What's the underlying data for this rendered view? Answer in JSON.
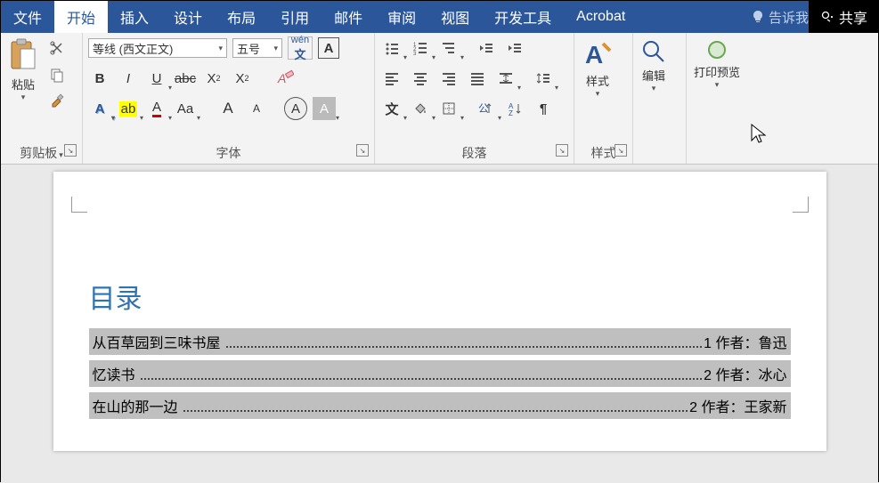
{
  "tabs": {
    "file": "文件",
    "home": "开始",
    "insert": "插入",
    "design": "设计",
    "layout": "布局",
    "refs": "引用",
    "mailings": "邮件",
    "review": "审阅",
    "view": "视图",
    "developer": "开发工具",
    "acrobat": "Acrobat",
    "tellme": "告诉我",
    "share": "共享"
  },
  "ribbon": {
    "clipboard": {
      "label": "剪贴板",
      "paste": "粘贴"
    },
    "font": {
      "label": "字体",
      "name": "等线 (西文正文)",
      "size": "五号",
      "pinyin": "wén"
    },
    "para": {
      "label": "段落"
    },
    "styles": {
      "label": "样式",
      "btn": "样式"
    },
    "editing": {
      "btn": "编辑"
    },
    "preview": {
      "btn": "打印预览"
    }
  },
  "doc": {
    "toc_title": "目录",
    "rows": [
      {
        "title": "从百草园到三味书屋",
        "page": "1 作者：鲁迅"
      },
      {
        "title": "忆读书",
        "page": "2 作者：冰心"
      },
      {
        "title": "在山的那一边",
        "page": "2 作者：王家新"
      }
    ]
  }
}
